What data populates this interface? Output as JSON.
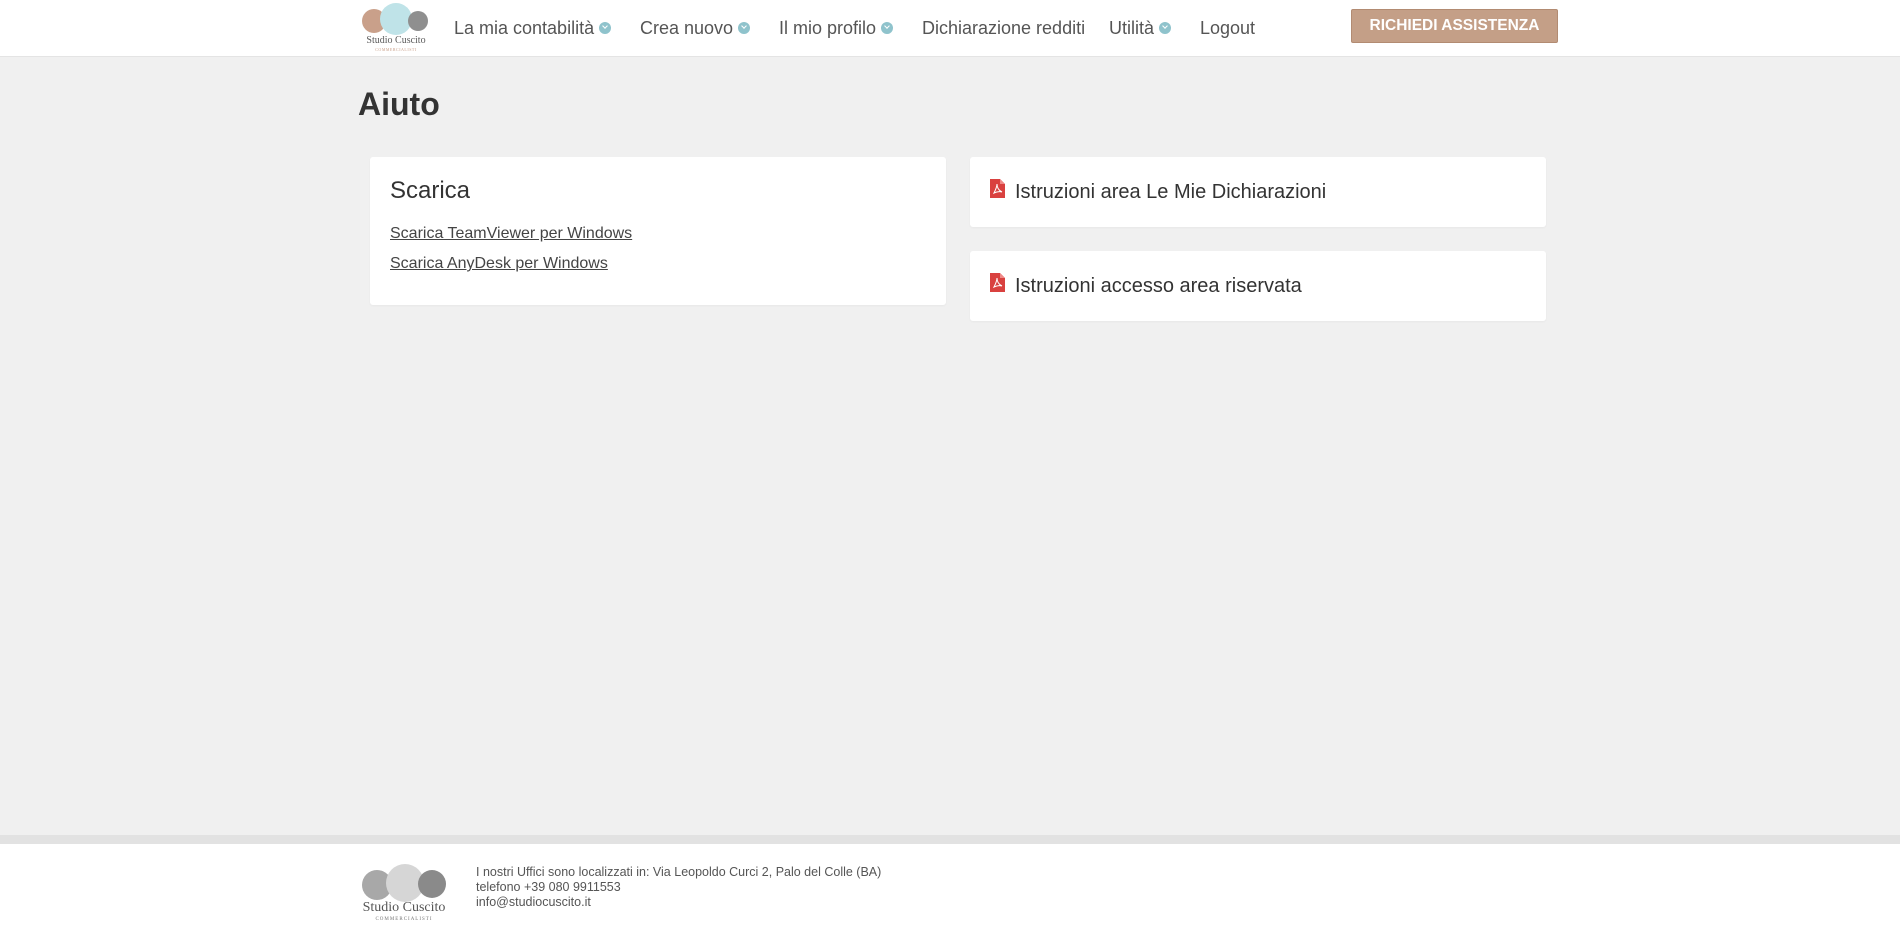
{
  "brand": {
    "name": "Studio Cuscito",
    "subtitle": "COMMERCIALISTI"
  },
  "nav": {
    "items": [
      {
        "label": "La mia contabilità",
        "has_dropdown": true
      },
      {
        "label": "Crea nuovo",
        "has_dropdown": true
      },
      {
        "label": "Il mio profilo",
        "has_dropdown": true
      },
      {
        "label": "Dichiarazione redditi",
        "has_dropdown": false
      },
      {
        "label": "Utilità",
        "has_dropdown": true
      },
      {
        "label": "Logout",
        "has_dropdown": false
      }
    ],
    "assist_button": "RICHIEDI ASSISTENZA"
  },
  "page": {
    "title": "Aiuto"
  },
  "download_card": {
    "title": "Scarica",
    "links": [
      "Scarica TeamViewer per Windows",
      "Scarica AnyDesk per Windows"
    ]
  },
  "documents": [
    {
      "label": "Istruzioni area Le Mie Dichiarazioni",
      "icon": "pdf-file-icon"
    },
    {
      "label": "Istruzioni accesso area riservata",
      "icon": "pdf-file-icon"
    }
  ],
  "footer": {
    "address": "I nostri Uffici sono localizzati in: Via Leopoldo Curci 2, Palo del Colle (BA)",
    "phone": "telefono +39 080 9911553",
    "email": "info@studiocuscito.it"
  },
  "colors": {
    "accent": "#c49f87",
    "chevron": "#8fc3cc",
    "pdf_red": "#d9413f",
    "background": "#f0f0f0"
  }
}
